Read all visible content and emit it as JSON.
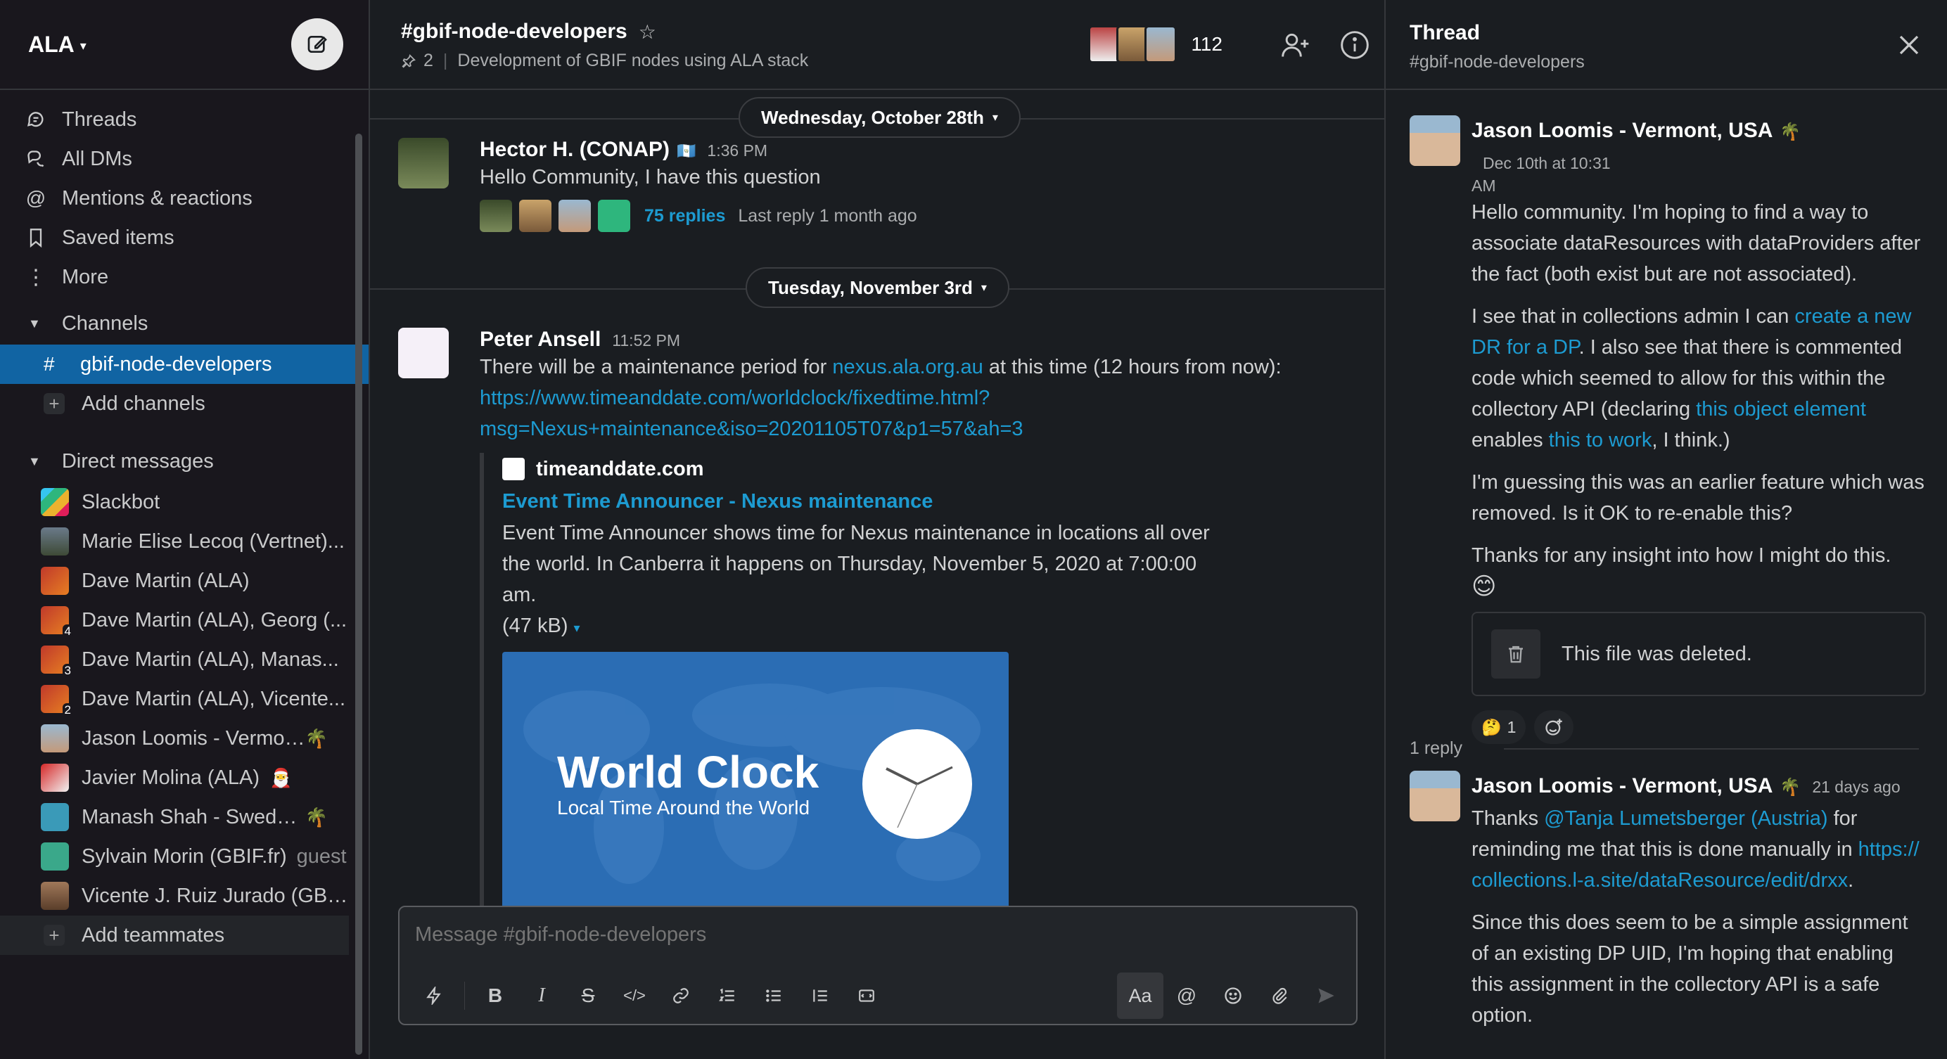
{
  "workspace": {
    "name": "ALA"
  },
  "sidebar": {
    "nav": [
      {
        "label": "Threads",
        "icon": "threads-icon"
      },
      {
        "label": "All DMs",
        "icon": "dms-icon"
      },
      {
        "label": "Mentions & reactions",
        "icon": "mention-icon"
      },
      {
        "label": "Saved items",
        "icon": "bookmark-icon"
      },
      {
        "label": "More",
        "icon": "more-icon"
      }
    ],
    "channels_header": "Channels",
    "channels": [
      {
        "label": "gbif-node-developers",
        "active": true
      }
    ],
    "add_channels": "Add channels",
    "dm_header": "Direct messages",
    "dms": [
      {
        "label": "Slackbot",
        "emoji": "",
        "badge": ""
      },
      {
        "label": "Marie Elise Lecoq (Vertnet)...",
        "emoji": "",
        "badge": ""
      },
      {
        "label": "Dave Martin (ALA)",
        "emoji": "",
        "badge": ""
      },
      {
        "label": "Dave Martin (ALA), Georg (...",
        "emoji": "",
        "badge": "4"
      },
      {
        "label": "Dave Martin (ALA), Manas...",
        "emoji": "",
        "badge": "3"
      },
      {
        "label": "Dave Martin (ALA), Vicente...",
        "emoji": "",
        "badge": "2"
      },
      {
        "label": "Jason Loomis - Vermon...",
        "emoji": "🌴",
        "badge": ""
      },
      {
        "label": "Javier Molina (ALA)",
        "emoji": "🎅",
        "badge": ""
      },
      {
        "label": "Manash Shah - Sweden...",
        "emoji": "🌴",
        "badge": ""
      },
      {
        "label": "Sylvain Morin (GBIF.fr)",
        "emoji": "",
        "badge": "",
        "guest": "guest"
      },
      {
        "label": "Vicente J. Ruiz Jurado (GBI...",
        "emoji": "",
        "badge": ""
      }
    ],
    "add_teammates": "Add teammates"
  },
  "channel": {
    "name": "#gbif-node-developers",
    "pins": "2",
    "topic": "Development of GBIF nodes using ALA stack",
    "member_count": "112"
  },
  "messages": {
    "date1": "Wednesday, October 28th",
    "date2": "Tuesday, November 3rd",
    "m1": {
      "author": "Hector H. (CONAP)",
      "flag": "🇬🇹",
      "time": "1:36 PM",
      "text": "Hello Community, I have this question",
      "replies": "75 replies",
      "last_reply": "Last reply 1 month ago"
    },
    "m2": {
      "author": "Peter Ansell",
      "time": "11:52 PM",
      "text_a": "There will be a maintenance period for ",
      "link_a": "nexus.ala.org.au",
      "text_b": " at this time (12 hours from now):",
      "url_line1": "https://www.timeanddate.com/worldclock/fixedtime.html?",
      "url_line2": "msg=Nexus+maintenance&iso=20201105T07&p1=57&ah=3",
      "unfurl_site": "timeanddate.com",
      "unfurl_title": "Event Time Announcer - Nexus maintenance",
      "unfurl_desc": "Event Time Announcer shows time for Nexus maintenance in locations all over the world. In Canberra it happens on Thursday, November 5, 2020 at 7:00:00 am.",
      "unfurl_size": "(47 kB)",
      "image_title": "World Clock",
      "image_sub": "Local Time Around the World"
    }
  },
  "composer": {
    "placeholder": "Message #gbif-node-developers",
    "aa": "Aa"
  },
  "thread": {
    "title": "Thread",
    "channel": "#gbif-node-developers",
    "parent": {
      "author": "Jason Loomis - Vermont, USA",
      "emoji": "🌴",
      "time_a": "Dec 10th at 10:31",
      "time_b": "AM",
      "p1": "Hello community. I'm hoping to find a way to associate dataResources with dataProviders after the fact (both exist but are not associated).",
      "p2_a": "I see that in collections admin I can ",
      "p2_link1": "create a new DR for a DP",
      "p2_b": ". I also see that there is commented code which seemed to allow for this within the collectory API (declaring ",
      "p2_link2": "this object element",
      "p2_c": " enables ",
      "p2_link3": "this to work",
      "p2_d": ", I think.)",
      "p3": "I'm guessing this was an earlier feature which was removed. Is it OK to re-enable this?",
      "p4": "Thanks for any insight into how I might do this.",
      "p4_emoji": "😊",
      "deleted": "This file was deleted.",
      "reaction_emoji": "🤔",
      "reaction_count": "1"
    },
    "reply_count": "1 reply",
    "reply": {
      "author": "Jason Loomis - Vermont, USA",
      "emoji": "🌴",
      "time": "21 days ago",
      "a": "Thanks ",
      "mention": "@Tanja Lumetsberger (Austria)",
      "b": " for reminding me that this is done manually in ",
      "url": "https://collections.l-a.site/dataResource/edit/drxx",
      "c": ".",
      "p2": "Since this does seem to be a simple assignment of an existing DP UID, I'm hoping that enabling this assignment in the collectory API is a safe option."
    }
  }
}
